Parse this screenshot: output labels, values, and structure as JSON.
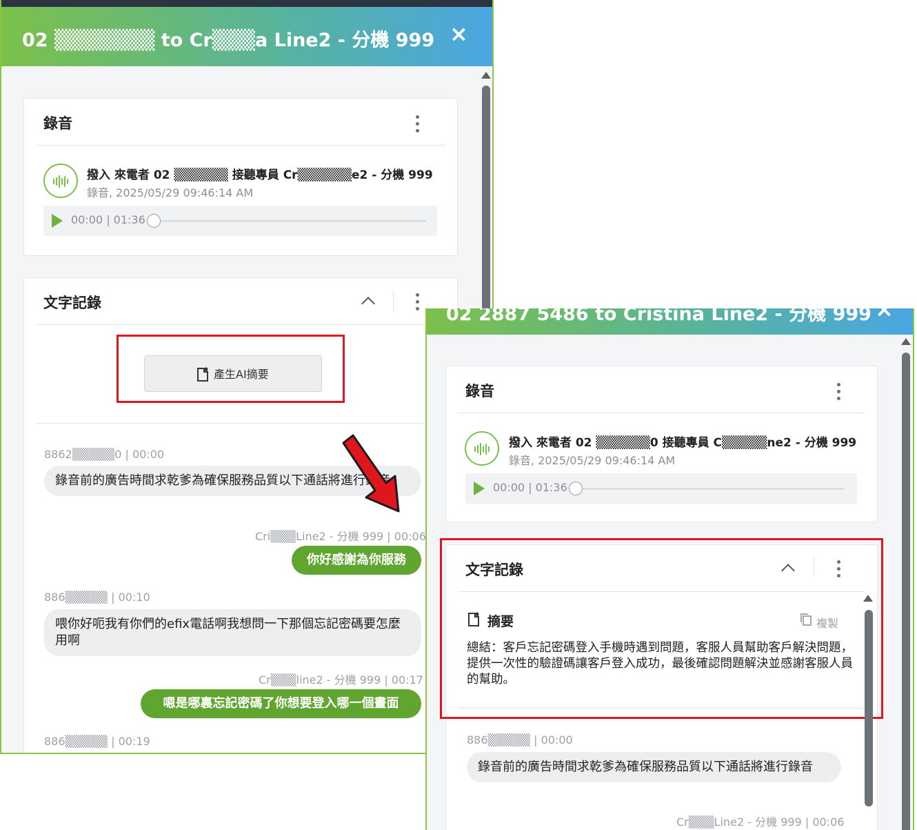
{
  "window": {
    "title": "02 ▒▒▒▒▒▒▒ to Cr▒▒▒a Line2 - 分機 999",
    "title_front": "02 2887 5486 to Cristina Line2 - 分機 999",
    "close_icon": "×"
  },
  "recording": {
    "title": "錄音",
    "description": "撥入 來電者 02 ▒▒▒▒▒▒ 接聽專員 Cr▒▒▒▒▒▒e2 - 分機 999",
    "description_front": "撥入 來電者 02 ▒▒▒▒▒▒0 接聽專員 C▒▒▒▒▒ne2 - 分機 999",
    "subtitle": "錄音, 2025/05/29 09:46:14 AM",
    "time": "00:00 | 01:36",
    "progress": 0
  },
  "transcript": {
    "title": "文字記錄",
    "ai_button": "產生AI摘要",
    "messages": [
      {
        "speaker": "8862▒▒▒▒▒0 | 00:00",
        "text": "錄音前的廣告時間求乾爹為確保服務品質以下通話將進行錄音",
        "direction": "in"
      },
      {
        "speaker": "Cri▒▒▒Line2 - 分機 999 | 00:06",
        "text": "你好感謝為你服務",
        "direction": "out"
      },
      {
        "speaker": "886▒▒▒▒▒ | 00:10",
        "text": "喂你好呃我有你們的efix電話啊我想問一下那個忘記密碼要怎麼用啊",
        "direction": "in"
      },
      {
        "speaker": "Cr▒▒▒line2 - 分機 999 | 00:17",
        "text": "嗯是哪裏忘記密碼了你想要登入哪一個畫面",
        "direction": "out"
      },
      {
        "speaker": "886▒▒▒▒▒ | 00:19",
        "text": "",
        "direction": "in"
      }
    ]
  },
  "summary": {
    "title": "摘要",
    "copy_label": "複製",
    "text": "總結：客戶忘記密碼登入手機時遇到問題，客服人員幫助客戶解決問題，提供一次性的驗證碼讓客戶登入成功，最後確認問題解決並感謝客服人員的幫助。"
  },
  "front_messages": [
    {
      "speaker": "886▒▒▒▒▒ | 00:00",
      "text": "錄音前的廣告時間求乾爹為確保服務品質以下通話將進行錄音",
      "direction": "in"
    },
    {
      "speaker": "Cr▒▒▒Line2 - 分機 999 | 00:06",
      "text": "",
      "direction": "out"
    }
  ],
  "colors": {
    "accent_green": "#5fa52f",
    "highlight_red": "#e0161e",
    "header_gradient_start": "#7cc04a",
    "header_gradient_end": "#4aa6e3"
  },
  "icons": [
    "close-icon",
    "kebab-menu-icon",
    "audio-wave-icon",
    "play-icon",
    "chevron-up-icon",
    "ai-document-icon",
    "copy-icon",
    "red-arrow"
  ]
}
